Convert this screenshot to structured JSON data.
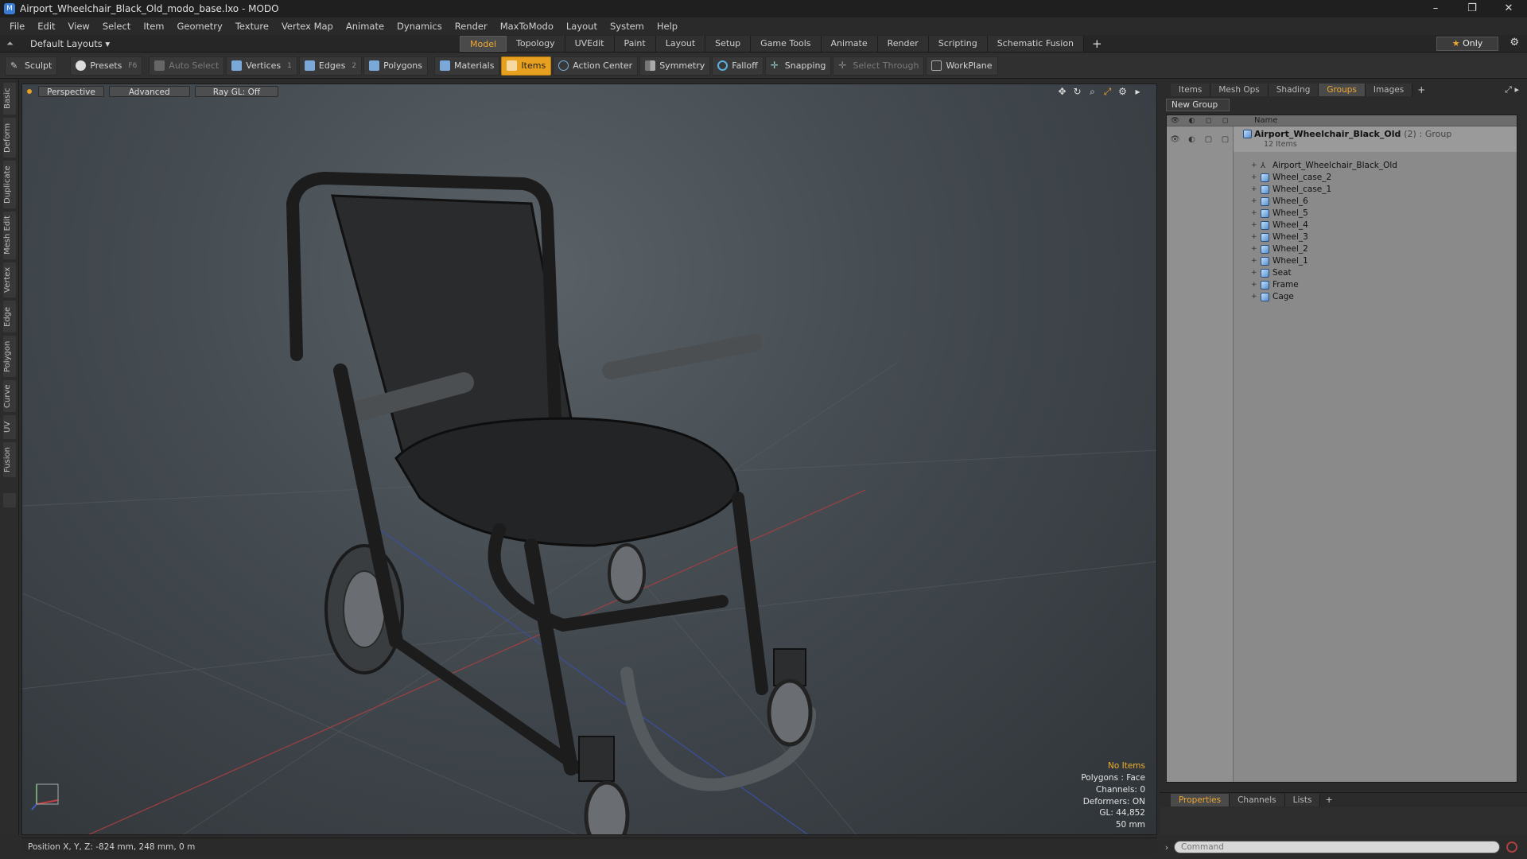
{
  "window": {
    "title": "Airport_Wheelchair_Black_Old_modo_base.lxo - MODO",
    "controls": [
      "–",
      "❐",
      "✕"
    ]
  },
  "menu": [
    "File",
    "Edit",
    "View",
    "Select",
    "Item",
    "Geometry",
    "Texture",
    "Vertex Map",
    "Animate",
    "Dynamics",
    "Render",
    "MaxToModo",
    "Layout",
    "System",
    "Help"
  ],
  "layoutbar": {
    "layouts_label": "Default Layouts ▾",
    "tabs": [
      "Model",
      "Topology",
      "UVEdit",
      "Paint",
      "Layout",
      "Setup",
      "Game Tools",
      "Animate",
      "Render",
      "Scripting",
      "Schematic Fusion"
    ],
    "active_tab": "Model",
    "only_label": "Only"
  },
  "toolbar": {
    "sculpt": "Sculpt",
    "presets": "Presets",
    "presets_key": "F6",
    "auto_select": "Auto Select",
    "vertices": "Vertices",
    "vertices_key": "1",
    "edges": "Edges",
    "edges_key": "2",
    "polygons": "Polygons",
    "materials": "Materials",
    "items": "Items",
    "action_center": "Action Center",
    "symmetry": "Symmetry",
    "falloff": "Falloff",
    "snapping": "Snapping",
    "select_through": "Select Through",
    "workplane": "WorkPlane"
  },
  "left_tabs": [
    "Basic",
    "Deform",
    "Duplicate",
    "Mesh Edit",
    "Vertex",
    "Edge",
    "Polygon",
    "Curve",
    "UV",
    "Fusion"
  ],
  "viewport": {
    "view_mode": "Perspective",
    "shading": "Advanced",
    "raygl": "Ray GL: Off",
    "info": {
      "selection": "No Items",
      "polygons": "Polygons : Face",
      "channels": "Channels: 0",
      "deformers": "Deformers: ON",
      "gl": "GL: 44,852",
      "scale": "50 mm"
    }
  },
  "status": {
    "position": "Position X, Y, Z:  -824 mm, 248 mm, 0 m"
  },
  "right_panel": {
    "tabs": [
      "Items",
      "Mesh Ops",
      "Shading",
      "Groups",
      "Images"
    ],
    "active_tab": "Groups",
    "new_group": "New Group",
    "column_name": "Name",
    "root": {
      "name": "Airport_Wheelchair_Black_Old",
      "count": "(2)",
      "type": ": Group",
      "sub": "12 Items"
    },
    "items": [
      {
        "name": "Airport_Wheelchair_Black_Old",
        "kind": "locator"
      },
      {
        "name": "Wheel_case_2",
        "kind": "mesh"
      },
      {
        "name": "Wheel_case_1",
        "kind": "mesh"
      },
      {
        "name": "Wheel_6",
        "kind": "mesh"
      },
      {
        "name": "Wheel_5",
        "kind": "mesh"
      },
      {
        "name": "Wheel_4",
        "kind": "mesh"
      },
      {
        "name": "Wheel_3",
        "kind": "mesh"
      },
      {
        "name": "Wheel_2",
        "kind": "mesh"
      },
      {
        "name": "Wheel_1",
        "kind": "mesh"
      },
      {
        "name": "Seat",
        "kind": "mesh"
      },
      {
        "name": "Frame",
        "kind": "mesh"
      },
      {
        "name": "Cage",
        "kind": "mesh"
      }
    ],
    "bottom_tabs": [
      "Properties",
      "Channels",
      "Lists"
    ],
    "bottom_active": "Properties",
    "command_placeholder": "Command"
  },
  "colors": {
    "accent": "#f0a830",
    "items_active": "#e8a020"
  }
}
